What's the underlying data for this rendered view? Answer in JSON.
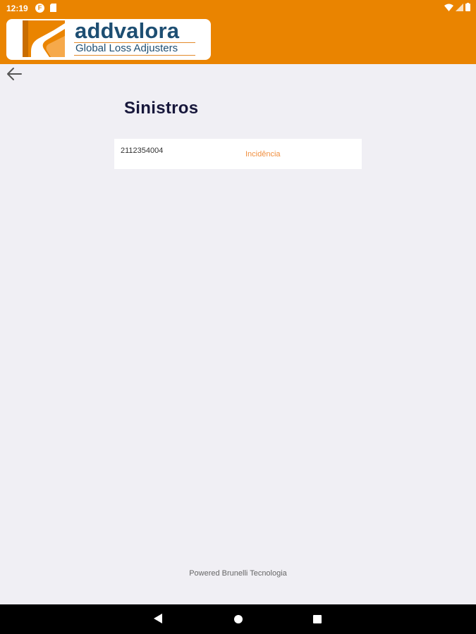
{
  "status_bar": {
    "time": "12:19",
    "notification_icon": "F",
    "sd_card_icon": "sd-card-icon",
    "wifi_icon": "wifi-icon",
    "signal_icon": "signal-icon",
    "battery_icon": "battery-icon"
  },
  "header": {
    "brand": "addvalora",
    "tagline": "Global Loss Adjusters",
    "color": "#ea8400",
    "brand_color": "#1d4e72"
  },
  "page": {
    "title": "Sinistros",
    "back_icon": "arrow-left-icon"
  },
  "claims": [
    {
      "number": "2112354004",
      "status": "Incidência"
    }
  ],
  "footer": {
    "text": "Powered Brunelli Tecnologia"
  },
  "nav_bar": {
    "back_icon": "triangle-back-icon",
    "home_icon": "circle-home-icon",
    "recents_icon": "square-recents-icon"
  }
}
